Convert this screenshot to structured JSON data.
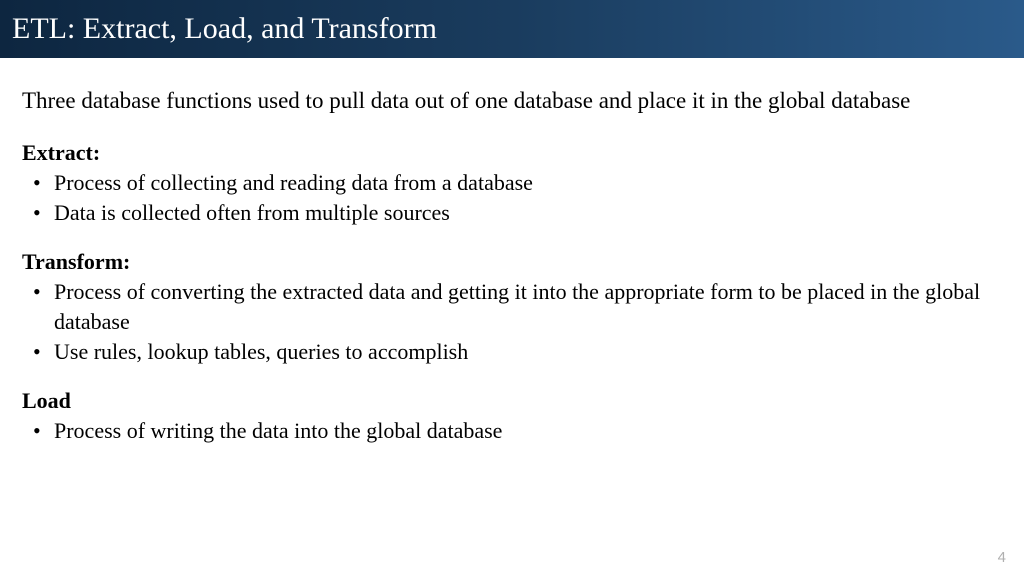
{
  "header": {
    "title": "ETL: Extract, Load, and Transform"
  },
  "intro": "Three database functions used to pull data out of one database and place it in the global database",
  "sections": [
    {
      "heading": "Extract:",
      "bullets": [
        "Process of collecting and reading data from a database",
        "Data is collected often from multiple sources"
      ]
    },
    {
      "heading": "Transform:",
      "bullets": [
        "Process of converting the extracted data and getting it into the appropriate form to be placed in the global database",
        "Use rules, lookup tables, queries to accomplish"
      ]
    },
    {
      "heading": "Load",
      "bullets": [
        "Process of writing the data into the global database"
      ]
    }
  ],
  "page_number": "4"
}
